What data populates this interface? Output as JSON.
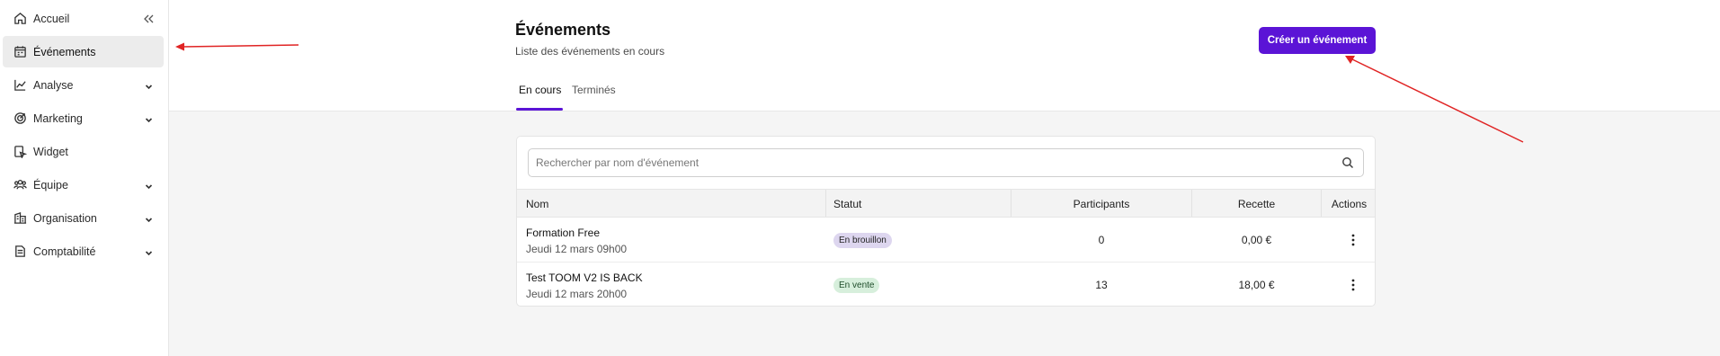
{
  "sidebar": {
    "items": [
      {
        "label": "Accueil",
        "icon": "home-icon",
        "has_chevron": false,
        "active": false
      },
      {
        "label": "Événements",
        "icon": "calendar-icon",
        "has_chevron": false,
        "active": true
      },
      {
        "label": "Analyse",
        "icon": "chart-line-icon",
        "has_chevron": true,
        "active": false
      },
      {
        "label": "Marketing",
        "icon": "target-icon",
        "has_chevron": true,
        "active": false
      },
      {
        "label": "Widget",
        "icon": "widget-icon",
        "has_chevron": false,
        "active": false
      },
      {
        "label": "Équipe",
        "icon": "team-icon",
        "has_chevron": true,
        "active": false
      },
      {
        "label": "Organisation",
        "icon": "building-icon",
        "has_chevron": true,
        "active": false
      },
      {
        "label": "Comptabilité",
        "icon": "document-icon",
        "has_chevron": true,
        "active": false
      }
    ]
  },
  "header": {
    "title": "Événements",
    "subtitle": "Liste des événements en cours",
    "create_button": "Créer un événement",
    "tabs": [
      {
        "label": "En cours",
        "active": true
      },
      {
        "label": "Terminés",
        "active": false
      }
    ]
  },
  "search": {
    "placeholder": "Rechercher par nom d'événement",
    "value": ""
  },
  "table": {
    "columns": [
      "Nom",
      "Statut",
      "Participants",
      "Recette",
      "Actions"
    ],
    "rows": [
      {
        "name": "Formation Free",
        "date": "Jeudi 12 mars 09h00",
        "status": "En brouillon",
        "status_kind": "draft",
        "participants": "0",
        "revenue": "0,00 €"
      },
      {
        "name": "Test TOOM V2 IS BACK",
        "date": "Jeudi 12 mars 20h00",
        "status": "En vente",
        "status_kind": "sale",
        "participants": "13",
        "revenue": "18,00 €"
      }
    ]
  },
  "colors": {
    "accent": "#5b14d6",
    "annotation_arrow": "#e02424",
    "badge_draft": "#ddd6ef",
    "badge_sale": "#d7efdc"
  }
}
